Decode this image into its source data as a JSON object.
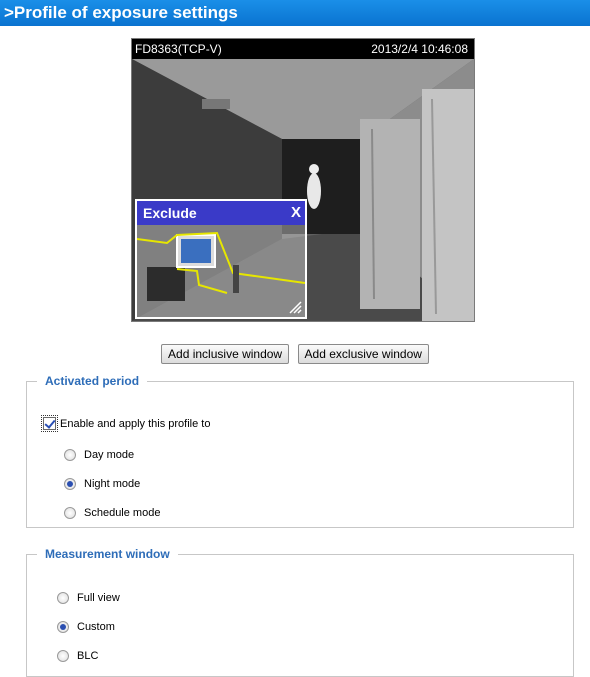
{
  "page": {
    "title": ">Profile of exposure settings"
  },
  "video": {
    "camera_id": "FD8363(TCP-V)",
    "timestamp": "2013/2/4 10:46:08",
    "exclude_window": {
      "label": "Exclude",
      "close_glyph": "X"
    }
  },
  "buttons": {
    "add_inclusive": "Add inclusive window",
    "add_exclusive": "Add exclusive window"
  },
  "activated_period": {
    "legend": "Activated period",
    "enable_label": "Enable and apply this profile to",
    "enable_checked": true,
    "options": [
      {
        "label": "Day mode",
        "selected": false
      },
      {
        "label": "Night mode",
        "selected": true
      },
      {
        "label": "Schedule mode",
        "selected": false
      }
    ]
  },
  "measurement_window": {
    "legend": "Measurement window",
    "options": [
      {
        "label": "Full view",
        "selected": false
      },
      {
        "label": "Custom",
        "selected": true
      },
      {
        "label": "BLC",
        "selected": false
      }
    ]
  },
  "colors": {
    "title_bar": "#0a73d0",
    "legend": "#2e6db8",
    "exclude_header": "#3a3ac8"
  }
}
